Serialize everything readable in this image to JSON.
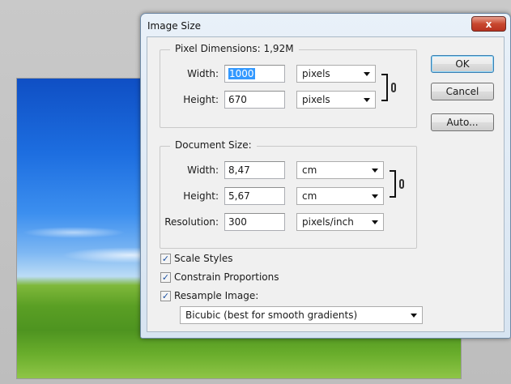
{
  "window": {
    "title": "Image Size",
    "close_glyph": "x"
  },
  "pixel_dimensions": {
    "title": "Pixel Dimensions:",
    "size": "1,92M",
    "width_label": "Width:",
    "width_value": "1000",
    "width_unit": "pixels",
    "height_label": "Height:",
    "height_value": "670",
    "height_unit": "pixels"
  },
  "document_size": {
    "title": "Document Size:",
    "width_label": "Width:",
    "width_value": "8,47",
    "width_unit": "cm",
    "height_label": "Height:",
    "height_value": "5,67",
    "height_unit": "cm",
    "resolution_label": "Resolution:",
    "resolution_value": "300",
    "resolution_unit": "pixels/inch"
  },
  "buttons": {
    "ok": "OK",
    "cancel": "Cancel",
    "auto": "Auto..."
  },
  "options": {
    "scale_styles": {
      "label": "Scale Styles",
      "checked": true
    },
    "constrain_proportions": {
      "label": "Constrain Proportions",
      "checked": true
    },
    "resample_image": {
      "label": "Resample Image:",
      "checked": true
    },
    "resample_method": "Bicubic (best for smooth gradients)"
  },
  "colors": {
    "close_button": "#c8482f",
    "selection": "#3399ff",
    "default_button_border": "#3c7fb1"
  },
  "icons": {
    "link": "chain-link-icon",
    "dropdown": "chevron-down-icon",
    "checkmark": "checkmark-icon"
  }
}
